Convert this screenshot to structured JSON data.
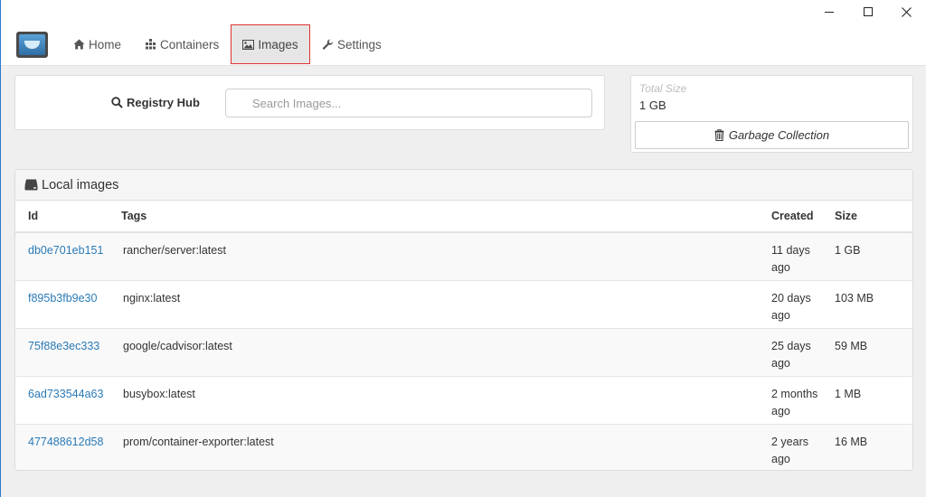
{
  "nav": {
    "home": "Home",
    "containers": "Containers",
    "images": "Images",
    "settings": "Settings"
  },
  "search": {
    "registry_label": "Registry Hub",
    "placeholder": "Search Images..."
  },
  "total_size": {
    "label": "Total Size",
    "value": "1 GB",
    "gc_label": "Garbage Collection"
  },
  "local_images": {
    "title": "Local images",
    "columns": [
      "Id",
      "Tags",
      "Created",
      "Size"
    ],
    "rows": [
      {
        "id": "db0e701eb151",
        "tags": "rancher/server:latest",
        "created": "11 days ago",
        "size": "1 GB"
      },
      {
        "id": "f895b3fb9e30",
        "tags": "nginx:latest",
        "created": "20 days ago",
        "size": "103 MB"
      },
      {
        "id": "75f88e3ec333",
        "tags": "google/cadvisor:latest",
        "created": "25 days ago",
        "size": "59 MB"
      },
      {
        "id": "6ad733544a63",
        "tags": "busybox:latest",
        "created": "2 months ago",
        "size": "1 MB"
      },
      {
        "id": "477488612d58",
        "tags": "prom/container-exporter:latest",
        "created": "2 years ago",
        "size": "16 MB"
      }
    ]
  },
  "colors": {
    "accent_link": "#2a7ab7",
    "active_tab_border": "#e0312f",
    "window_accent": "#2b79d0"
  },
  "icons": [
    "minimize-icon",
    "maximize-icon",
    "close-icon",
    "app-logo-icon",
    "home-icon",
    "containers-icon",
    "images-icon",
    "wrench-icon",
    "search-icon",
    "trash-icon",
    "hdd-icon"
  ]
}
